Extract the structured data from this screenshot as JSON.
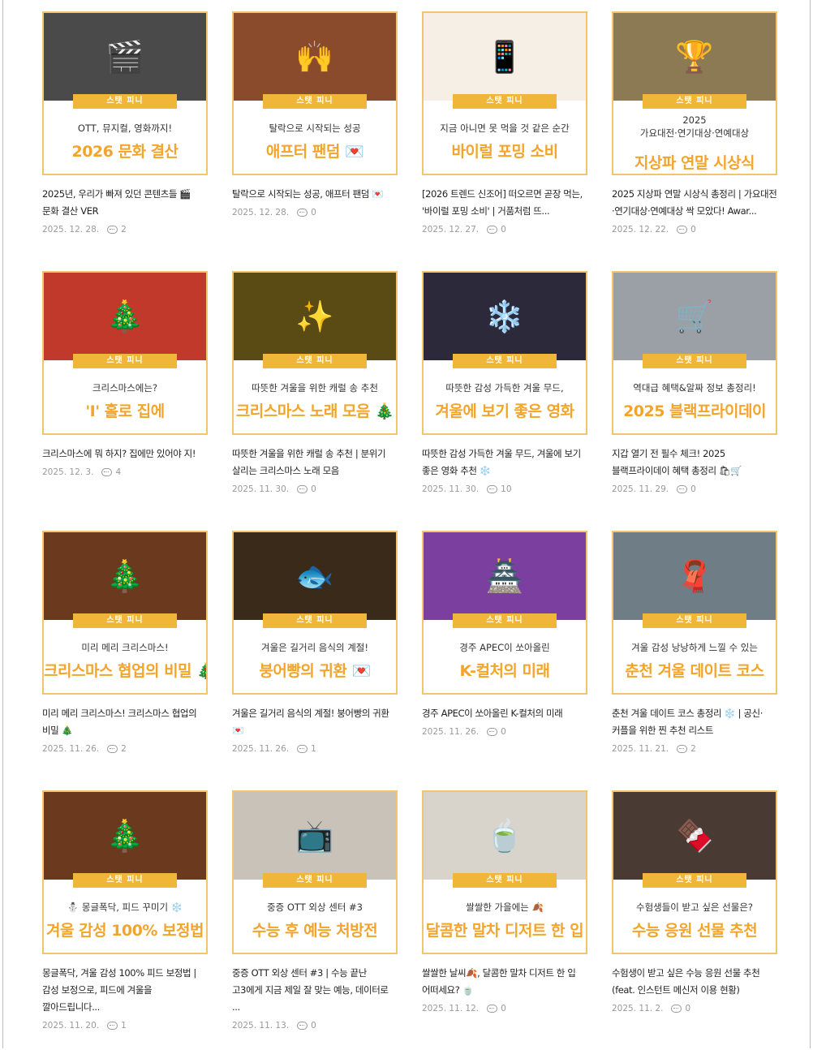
{
  "tag_label": "스탯 피니",
  "posts": [
    {
      "icon": "🎬",
      "bg": "#4a4a4a",
      "cap1": "OTT, 뮤지컬, 영화까지!",
      "cap2": "2026 문화 결산",
      "title": "2025년, 우리가 빠져 있던 콘텐츠들 🎬 문화 결산 VER",
      "date": "2025. 12. 28.",
      "comments": "2"
    },
    {
      "icon": "🙌",
      "bg": "#8a4a2c",
      "cap1": "탈락으로 시작되는 성공",
      "cap2": "애프터 팬덤 💌",
      "title": "탈락으로 시작되는 성공, 애프터 팬덤 💌",
      "date": "2025. 12. 28.",
      "comments": "0"
    },
    {
      "icon": "📱",
      "bg": "#f6efe6",
      "cap1": "지금 아니면 못 먹을 것 같은 순간",
      "cap2": "바이럴 포밍 소비",
      "title": "[2026 트렌드 신조어] 떠오르면 곧장 먹는, '바이럴 포밍 소비' | 거품처럼 뜨...",
      "date": "2025. 12. 27.",
      "comments": "0"
    },
    {
      "icon": "🏆",
      "bg": "#8c7a55",
      "cap1": "2025\n가요대전·연기대상·연예대상",
      "cap2": "지상파 연말 시상식",
      "two": true,
      "title": "2025 지상파 연말 시상식 총정리 | 가요대전·연기대상·연예대상 싹 모았다! Awar...",
      "date": "2025. 12. 22.",
      "comments": "0"
    },
    {
      "icon": "🎄",
      "bg": "#c0392b",
      "cap1": "크리스마스에는?",
      "cap2": "'I' 홀로 집에",
      "title": "크리스마스에 뭐 하지? 집에만 있어야 지!",
      "date": "2025. 12. 3.",
      "comments": "4"
    },
    {
      "icon": "✨",
      "bg": "#5a4a14",
      "cap1": "따뜻한 겨울을 위한 캐럴 송 추천",
      "cap2": "크리스마스 노래 모음 🎄",
      "title": "따뜻한 겨울을 위한 캐럴 송 추천 | 분위기 살리는 크리스마스 노래 모음",
      "date": "2025. 11. 30.",
      "comments": "0"
    },
    {
      "icon": "❄️",
      "bg": "#2c2a3a",
      "cap1": "따뜻한 감성 가득한 겨울 무드,",
      "cap2": "겨울에 보기 좋은 영화",
      "title": "따뜻한 감성 가득한 겨울 무드, 겨울에 보기 좋은 영화 추천 ❄️",
      "date": "2025. 11. 30.",
      "comments": "10"
    },
    {
      "icon": "🛒",
      "bg": "#9aa0a6",
      "cap1": "역대급 혜택&알짜 정보 총정리!",
      "cap2": "2025 블랙프라이데이",
      "title": "지갑 열기 전 필수 체크! 2025 블랙프라이데이 혜택 총정리 🛍🛒",
      "date": "2025. 11. 29.",
      "comments": "0"
    },
    {
      "icon": "🎄",
      "bg": "#6b3a1e",
      "cap1": "미리 메리 크리스마스!",
      "cap2": "크리스마스 협업의 비밀 🎄",
      "title": "미리 메리 크리스마스! 크리스마스 협업의 비밀 🎄",
      "date": "2025. 11. 26.",
      "comments": "2"
    },
    {
      "icon": "🐟",
      "bg": "#3a2a1a",
      "cap1": "겨울은 길거리 음식의 계절!",
      "cap2": "붕어빵의 귀환 💌",
      "title": "겨울은 길거리 음식의 계절! 붕어빵의 귀환 💌",
      "date": "2025. 11. 26.",
      "comments": "1"
    },
    {
      "icon": "🏯",
      "bg": "#7b3fa0",
      "cap1": "경주 APEC이 쏘아올린",
      "cap2": "K-컬처의 미래",
      "title": "경주 APEC이 쏘아올린 K-컬처의 미래",
      "date": "2025. 11. 26.",
      "comments": "0"
    },
    {
      "icon": "🧣",
      "bg": "#6e7d86",
      "cap1": "겨울 감성 낭낭하게 느낄 수 있는",
      "cap2": "춘천 겨울 데이트 코스",
      "title": "춘천 겨울 데이트 코스 총정리 ❄️ | 공신·커플을 위한 찐 추천 리스트",
      "date": "2025. 11. 21.",
      "comments": "2"
    },
    {
      "icon": "🎄",
      "bg": "#6b3a1e",
      "cap1": "⛄ 몽글폭닥, 피드 꾸미기 ❄️",
      "cap2": "겨울 감성 100% 보정법",
      "title": "몽글폭닥, 겨울 감성 100% 피드 보정법 | 감성 보정으로, 피드에 겨울을 깔아드립니다...",
      "date": "2025. 11. 20.",
      "comments": "1"
    },
    {
      "icon": "📺",
      "bg": "#c9c2b8",
      "cap1": "중증 OTT 외상 센터 #3",
      "cap2": "수능 후 예능 처방전",
      "title": "중증 OTT 외상 센터 #3 | 수능 끝난 고3에게 지금 제일 잘 맞는 예능, 데이터로 ...",
      "date": "2025. 11. 13.",
      "comments": "0"
    },
    {
      "icon": "🍵",
      "bg": "#d8d4cc",
      "cap1": "쌀쌀한 가을에는 🍂",
      "cap2": "달콤한 말차 디저트 한 입",
      "title": "쌀쌀한 날씨🍂, 달콤한 말차 디저트 한 입 어떠세요? 🍵",
      "date": "2025. 11. 12.",
      "comments": "0"
    },
    {
      "icon": "🍫",
      "bg": "#4a3a34",
      "cap1": "수험생들이 받고 싶은 선물은?",
      "cap2": "수능 응원 선물 추천",
      "title": "수험생이 받고 싶은 수능 응원 선물 추천 (feat. 인스턴트 메신저 이용 현황)",
      "date": "2025. 11. 2.",
      "comments": "0"
    }
  ]
}
